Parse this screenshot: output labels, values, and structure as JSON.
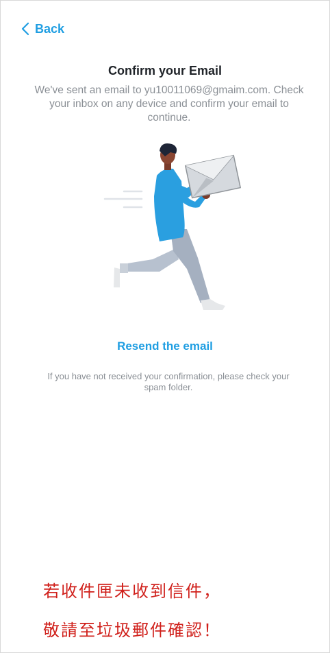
{
  "nav": {
    "back_label": "Back"
  },
  "main": {
    "title": "Confirm your Email",
    "description": "We've sent an email to yu10011069@gmaim.com. Check your inbox on any device and confirm your email to continue.",
    "resend_label": "Resend the email",
    "spam_note": "If you have not received your confirmation, please check your spam folder."
  },
  "annotation": {
    "line1": "若收件匣未收到信件，",
    "line2": "敬請至垃圾郵件確認！"
  },
  "icons": {
    "back": "chevron-left-icon",
    "illustration": "man-running-with-envelope"
  },
  "colors": {
    "accent": "#1f9ee2",
    "title": "#1f2328",
    "muted": "#8a8f95",
    "annotation_red": "#d0201b",
    "shirt_blue": "#2a9fe0",
    "pants_gray": "#a9b4c4"
  }
}
